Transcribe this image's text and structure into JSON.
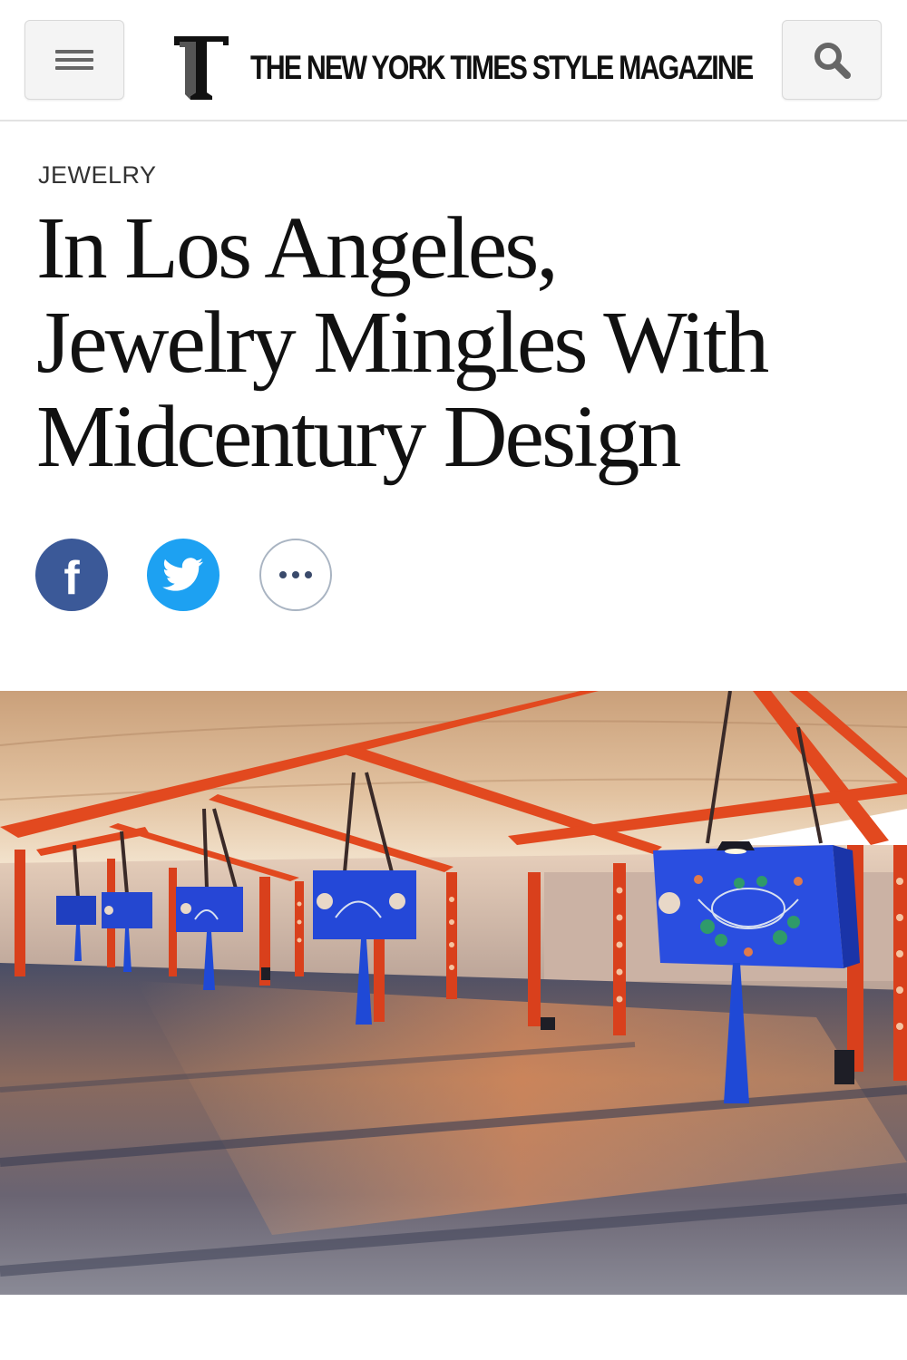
{
  "header": {
    "menu_icon": "hamburger-menu-icon",
    "logo_letter": "T",
    "masthead": "THE NEW YORK TIMES STYLE MAGAZINE",
    "search_icon": "search-icon"
  },
  "article": {
    "kicker": "JEWELRY",
    "headline_lines": [
      "In Los Angeles,",
      "Jewelry Mingles With",
      "Midcentury Design"
    ]
  },
  "share": {
    "items": [
      {
        "name": "facebook",
        "icon": "facebook-icon",
        "color": "#3b5998",
        "glyph": "f"
      },
      {
        "name": "twitter",
        "icon": "twitter-bird-icon",
        "color": "#1da1f2"
      },
      {
        "name": "more",
        "icon": "more-dots-icon",
        "color": "#ffffff"
      }
    ]
  },
  "hero": {
    "subject": "photo"
  },
  "colors": {
    "text": "#111111",
    "header_border": "#e2e2e2",
    "button_bg": "#f4f4f4"
  }
}
